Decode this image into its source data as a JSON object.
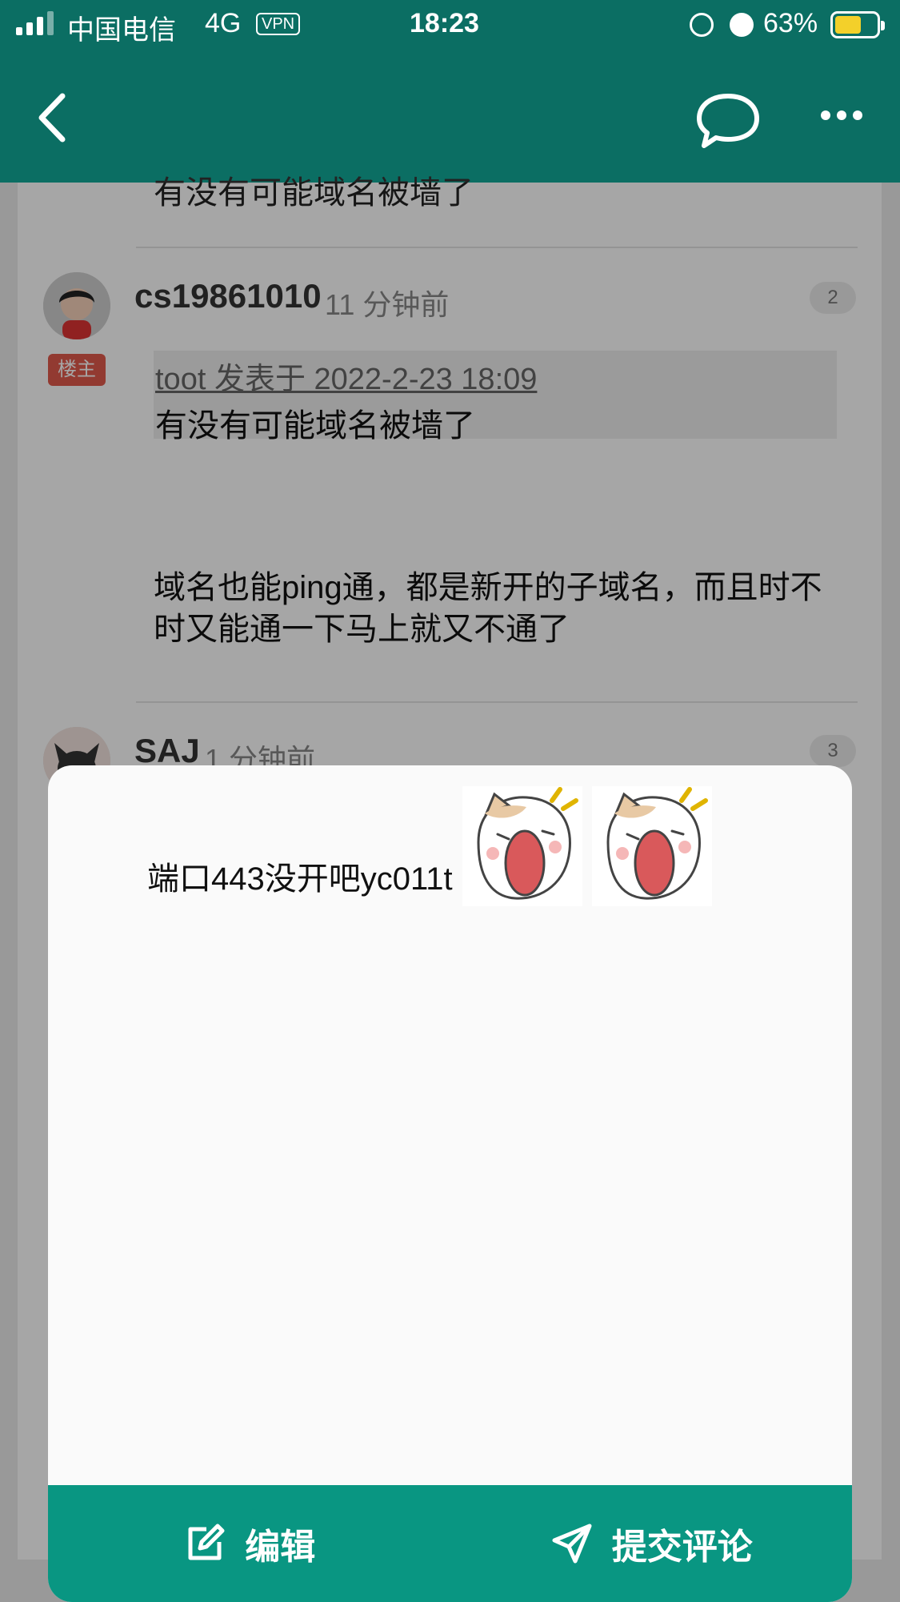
{
  "status_bar": {
    "carrier": "中国电信",
    "network": "4G",
    "vpn": "VPN",
    "time": "18:23",
    "battery_percent": "63%",
    "battery_level": 0.63,
    "icons": [
      "signal-icon",
      "rotation-lock-icon",
      "alarm-icon",
      "battery-icon"
    ]
  },
  "app_bar": {
    "icons": [
      "back-icon",
      "comment-bubble-icon",
      "more-options-icon"
    ]
  },
  "thread": {
    "previous_post_tail": "有没有可能域名被墙了",
    "replies": [
      {
        "user": "cs19861010",
        "time": "11 分钟前",
        "floor": "2",
        "badge": "楼主",
        "quote_header": "toot 发表于 2022-2-23 18:09",
        "quote_text": "有没有可能域名被墙了",
        "body": "域名也能ping通，都是新开的子域名，而且时不时又能通一下马上就又不通了"
      },
      {
        "user": "SAJ",
        "time": "1 分钟前",
        "floor": "3"
      }
    ]
  },
  "compose": {
    "draft_text": "端口443没开吧yc011t",
    "stickers": [
      "shouting-cat-sticker",
      "shouting-cat-sticker"
    ],
    "edit_label": "编辑",
    "submit_label": "提交评论"
  },
  "colors": {
    "primary": "#0b6e63",
    "footer": "#099682",
    "badge": "#e05a4c",
    "battery": "#f3d02a"
  }
}
